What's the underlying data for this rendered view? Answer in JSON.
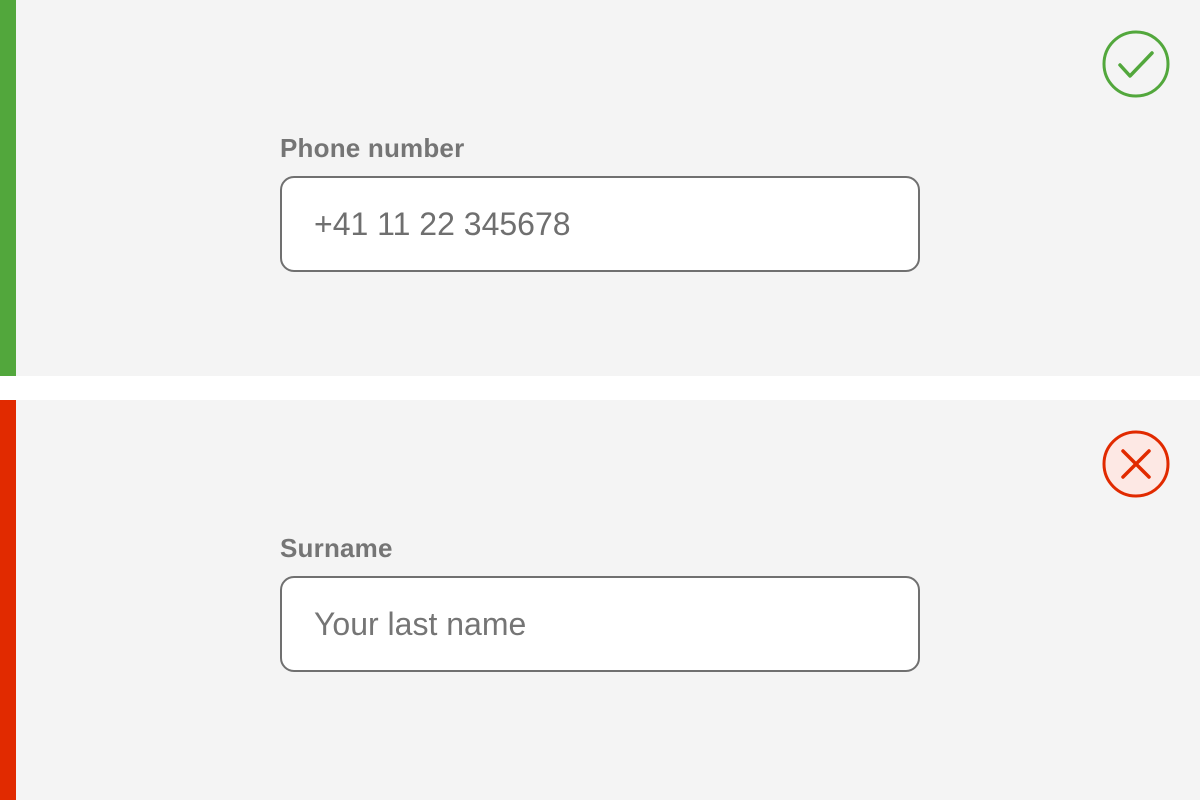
{
  "colors": {
    "success": "#52a73c",
    "error": "#e12a00",
    "panel_background": "#f4f4f4",
    "text": "#757575"
  },
  "valid_field": {
    "status_icon": "checkmark-circle-icon",
    "label": "Phone number",
    "value": "+41 11 22 345678"
  },
  "invalid_field": {
    "status_icon": "x-circle-icon",
    "label": "Surname",
    "value": "",
    "placeholder": "Your last name"
  }
}
